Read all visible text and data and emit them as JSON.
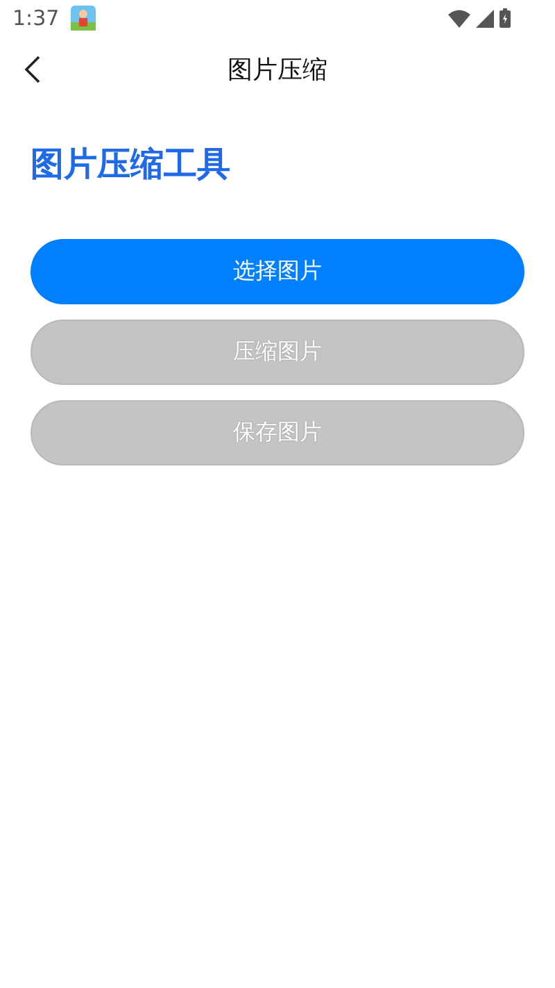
{
  "status_bar": {
    "time": "1:37"
  },
  "app_bar": {
    "title": "图片压缩"
  },
  "heading": "图片压缩工具",
  "buttons": [
    {
      "label": "选择图片",
      "disabled": false
    },
    {
      "label": "压缩图片",
      "disabled": true
    },
    {
      "label": "保存图片",
      "disabled": true
    }
  ]
}
